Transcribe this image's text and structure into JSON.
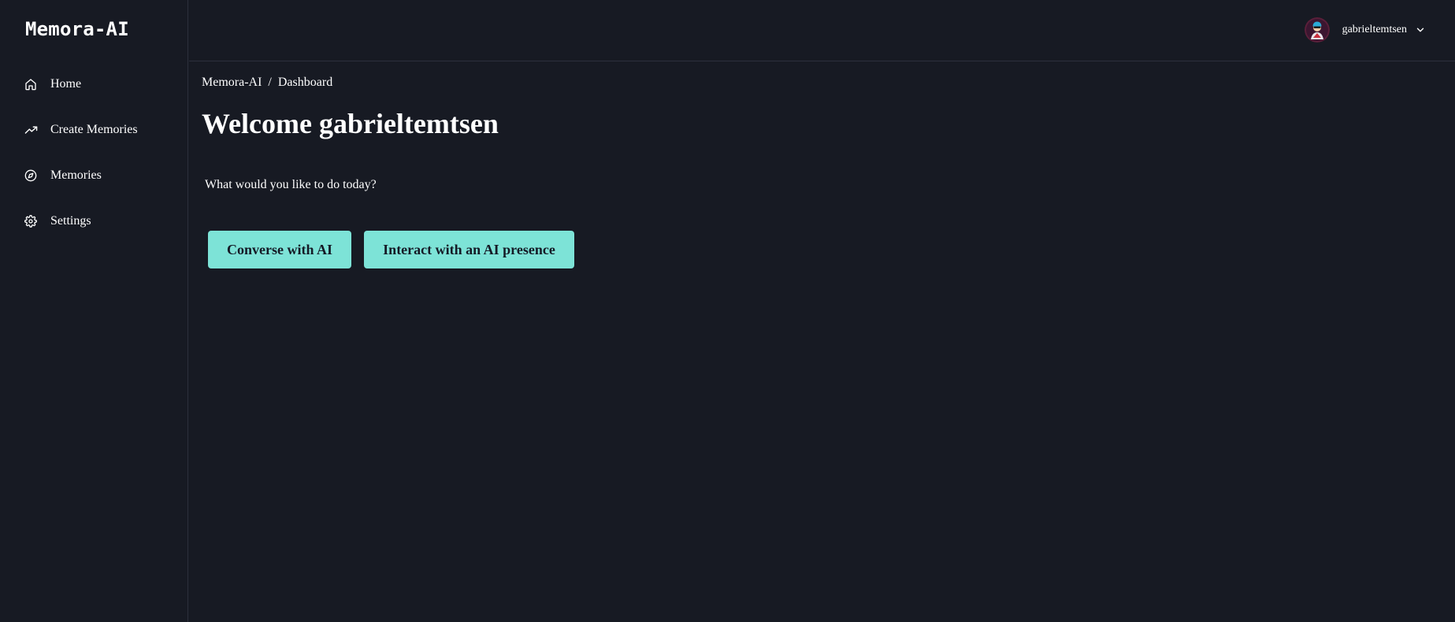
{
  "app": {
    "logo": "Memora-AI"
  },
  "sidebar": {
    "items": [
      {
        "label": "Home",
        "icon": "home-icon"
      },
      {
        "label": "Create Memories",
        "icon": "trending-up-icon"
      },
      {
        "label": "Memories",
        "icon": "compass-icon"
      },
      {
        "label": "Settings",
        "icon": "gear-icon"
      }
    ]
  },
  "header": {
    "username": "gabrieltemtsen",
    "avatar_icon": "avatar-image",
    "menu_icon": "chevron-down-icon"
  },
  "breadcrumb": {
    "root": "Memora-AI",
    "separator": "/",
    "current": "Dashboard"
  },
  "main": {
    "title": "Welcome gabrieltemtsen",
    "prompt": "What would you like to do today?",
    "buttons": {
      "converse": "Converse with AI",
      "interact": "Interact with an AI presence"
    }
  },
  "colors": {
    "background": "#171a23",
    "accent": "#7de3d7",
    "button_text": "#151a26",
    "border": "#2c303c"
  }
}
